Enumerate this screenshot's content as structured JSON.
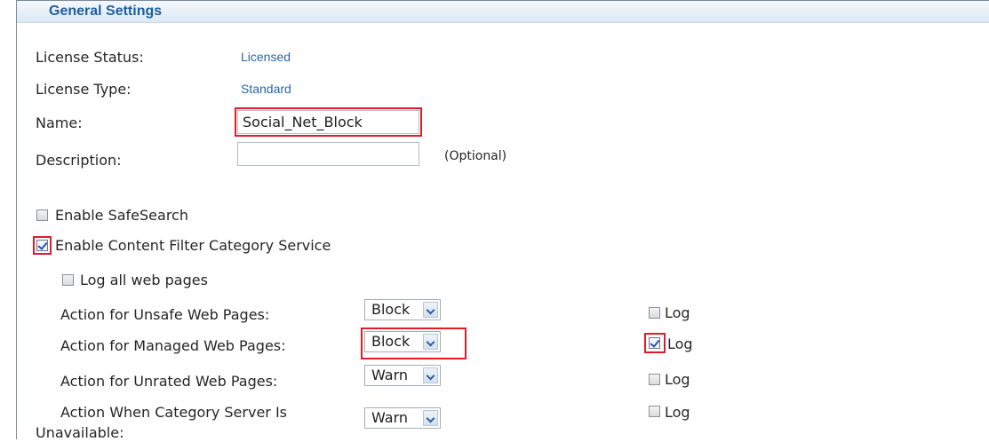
{
  "section": {
    "title": "General Settings"
  },
  "license_status": {
    "label": "License Status:",
    "value": "Licensed"
  },
  "license_type": {
    "label": "License Type:",
    "value": "Standard"
  },
  "name": {
    "label": "Name:",
    "value": "Social_Net_Block"
  },
  "description": {
    "label": "Description:",
    "value": "",
    "note": "(Optional)"
  },
  "safesearch": {
    "label": "Enable SafeSearch",
    "checked": false
  },
  "content_filter": {
    "label": "Enable Content Filter Category Service",
    "checked": true
  },
  "log_all": {
    "label": "Log all web pages",
    "checked": false
  },
  "actions": [
    {
      "label": "Action for Unsafe Web Pages:",
      "value": "Block",
      "log_label": "Log",
      "log_checked": false
    },
    {
      "label": "Action for Managed Web Pages:",
      "value": "Block",
      "log_label": "Log",
      "log_checked": true
    },
    {
      "label": "Action for Unrated Web Pages:",
      "value": "Warn",
      "log_label": "Log",
      "log_checked": false
    },
    {
      "label_line1": "Action When Category Server Is",
      "label_line2": "Unavailable:",
      "value": "Warn",
      "log_label": "Log",
      "log_checked": false
    }
  ],
  "colors": {
    "accent": "#1f5f9b",
    "link_value": "#2a65a8",
    "highlight": "#e21a2a"
  }
}
